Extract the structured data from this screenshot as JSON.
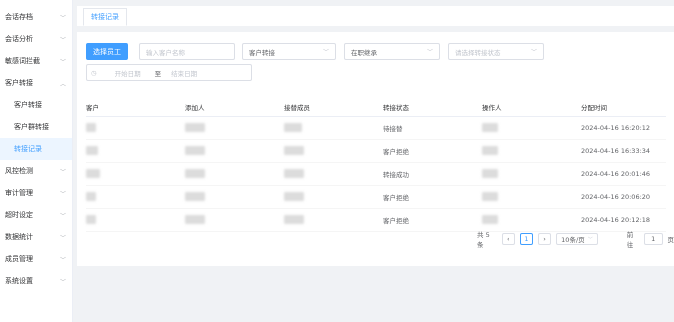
{
  "sidebar": {
    "items": [
      {
        "label": "会话存档",
        "has_chevron": true
      },
      {
        "label": "会话分析",
        "has_chevron": true
      },
      {
        "label": "敏感词拦截",
        "has_chevron": true
      },
      {
        "label": "客户转接",
        "has_chevron": true,
        "expanded": true
      }
    ],
    "sub_items": [
      {
        "label": "客户转接",
        "active": false
      },
      {
        "label": "客户群转接",
        "active": false
      },
      {
        "label": "转接记录",
        "active": true
      }
    ],
    "items_after": [
      {
        "label": "风控检测"
      },
      {
        "label": "审计管理"
      },
      {
        "label": "超时设定"
      },
      {
        "label": "数据统计"
      },
      {
        "label": "成员管理"
      },
      {
        "label": "系统设置"
      }
    ]
  },
  "tabs": [
    {
      "label": "转接记录",
      "active": true
    }
  ],
  "filters": {
    "select_employee_button": "选择员工",
    "customer_name_placeholder": "输入客户名称",
    "transfer_type_value": "客户转接",
    "employment_status_value": "在职继承",
    "transfer_status_placeholder": "请选择转接状态",
    "start_date_placeholder": "开始日期",
    "end_date_placeholder": "结束日期",
    "date_separator": "至"
  },
  "table": {
    "columns": [
      "客户",
      "添加人",
      "接替成员",
      "转接状态",
      "操作人",
      "分配时间"
    ],
    "rows": [
      {
        "status": "待接替",
        "time": "2024-04-16 16:20:12"
      },
      {
        "status": "客户拒绝",
        "time": "2024-04-16 16:33:34"
      },
      {
        "status": "转接成功",
        "time": "2024-04-16 20:01:46"
      },
      {
        "status": "客户拒绝",
        "time": "2024-04-16 20:06:20"
      },
      {
        "status": "客户拒绝",
        "time": "2024-04-16 20:12:18"
      }
    ]
  },
  "pagination": {
    "total_text": "共 5 条",
    "current_page": "1",
    "page_size": "10条/页",
    "goto_label": "前往",
    "goto_value": "1",
    "page_suffix": "页"
  },
  "colors": {
    "primary": "#409eff"
  }
}
